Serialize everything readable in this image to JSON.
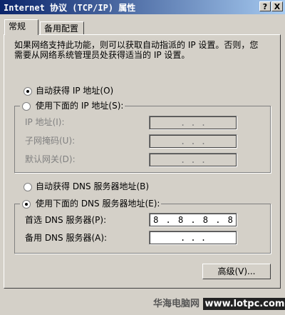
{
  "window": {
    "title": "Internet 协议 (TCP/IP) 属性",
    "help_btn": "?",
    "close_btn": "X"
  },
  "tabs": [
    {
      "label": "常规"
    },
    {
      "label": "备用配置"
    }
  ],
  "description": "如果网络支持此功能，则可以获取自动指派的 IP 设置。否则，您需要从网络系统管理员处获得适当的 IP 设置。",
  "ip": {
    "auto_label": "自动获得 IP 地址(O)",
    "manual_label": "使用下面的 IP 地址(S):",
    "fields": [
      {
        "label": "IP 地址(I):",
        "value": ". . ."
      },
      {
        "label": "子网掩码(U):",
        "value": ". . ."
      },
      {
        "label": "默认网关(D):",
        "value": ". . ."
      }
    ]
  },
  "dns": {
    "auto_label": "自动获得 DNS 服务器地址(B)",
    "manual_label": "使用下面的 DNS 服务器地址(E):",
    "preferred": {
      "label": "首选 DNS 服务器(P):",
      "octets": [
        "8",
        "8",
        "8",
        "8"
      ]
    },
    "alternate": {
      "label": "备用 DNS 服务器(A):",
      "value": ". . ."
    }
  },
  "advanced_button": "高级(V)...",
  "watermark": {
    "site": "华海电脑网",
    "url": "www.lotpc.com"
  }
}
